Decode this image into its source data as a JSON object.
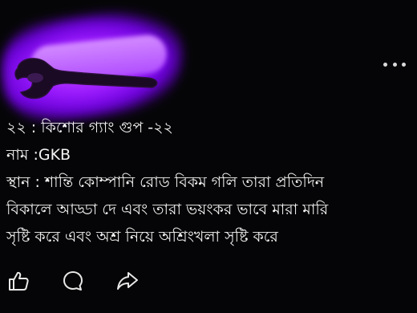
{
  "post": {
    "lines": [
      "২২ : কিশোর গ্যাং গুপ -২২",
      "নাম :GKB",
      "স্থান : শান্তি কোম্পানি রোড বিকম গলি তারা প্রতিদিন",
      "বিকালে আড্ডা দে এবং তারা ভয়ংকর ভাবে  মারা মারি",
      "সৃষ্টি করে এবং অশ্র নিয়ে অশ্রিংখলা সৃষ্টি করে"
    ]
  },
  "actions": {
    "like_icon": "thumbs-up-icon",
    "comment_icon": "speech-bubble-icon",
    "share_icon": "share-arrow-icon"
  },
  "colors": {
    "background": "#050507",
    "glow": "#9b1bff",
    "text": "#f4f4f4"
  }
}
